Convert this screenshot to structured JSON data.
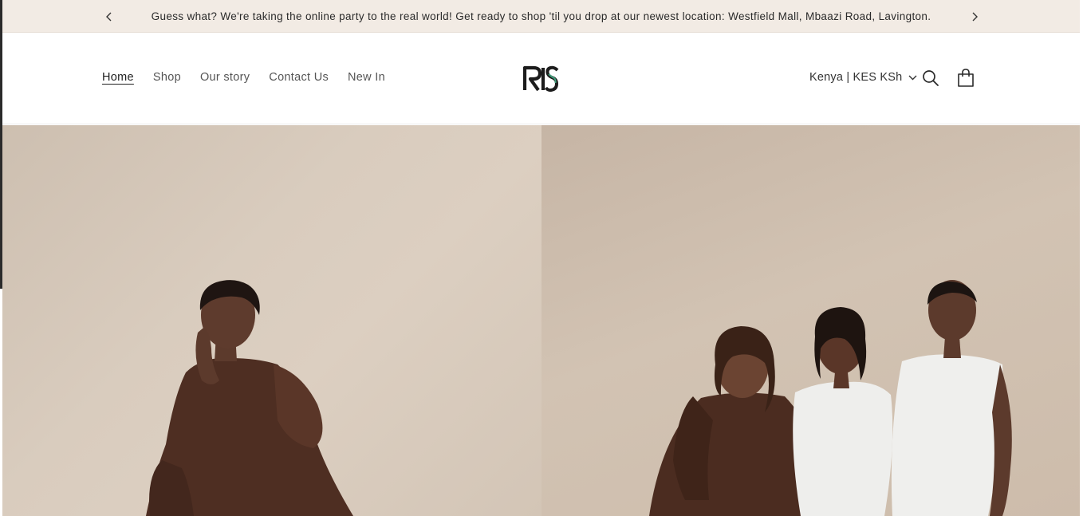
{
  "announcement": {
    "text": "Guess what? We're taking the online party to the real world! Get ready to shop 'til you drop at our newest location: Westfield Mall, Mbaazi Road, Lavington.",
    "prev_icon": "chevron-left-icon",
    "next_icon": "chevron-right-icon"
  },
  "nav": {
    "items": [
      {
        "label": "Home",
        "active": true
      },
      {
        "label": "Shop",
        "active": false
      },
      {
        "label": "Our story",
        "active": false
      },
      {
        "label": "Contact Us",
        "active": false
      },
      {
        "label": "New In",
        "active": false
      }
    ]
  },
  "brand": {
    "logo_text": "RIS",
    "logo_color": "#1c1c1c",
    "logo_accent": "#3f9e7a"
  },
  "header_actions": {
    "currency": "Kenya | KES KSh",
    "currency_icon": "chevron-down-icon",
    "search_icon": "search-icon",
    "cart_icon": "cart-icon"
  },
  "hero": {
    "left_image": "woman-in-brown-outfit-seated",
    "right_image": "three-women-brown-and-white-outfits",
    "bg_left": "#d6c9ba",
    "bg_right": "#cbbaa9"
  }
}
